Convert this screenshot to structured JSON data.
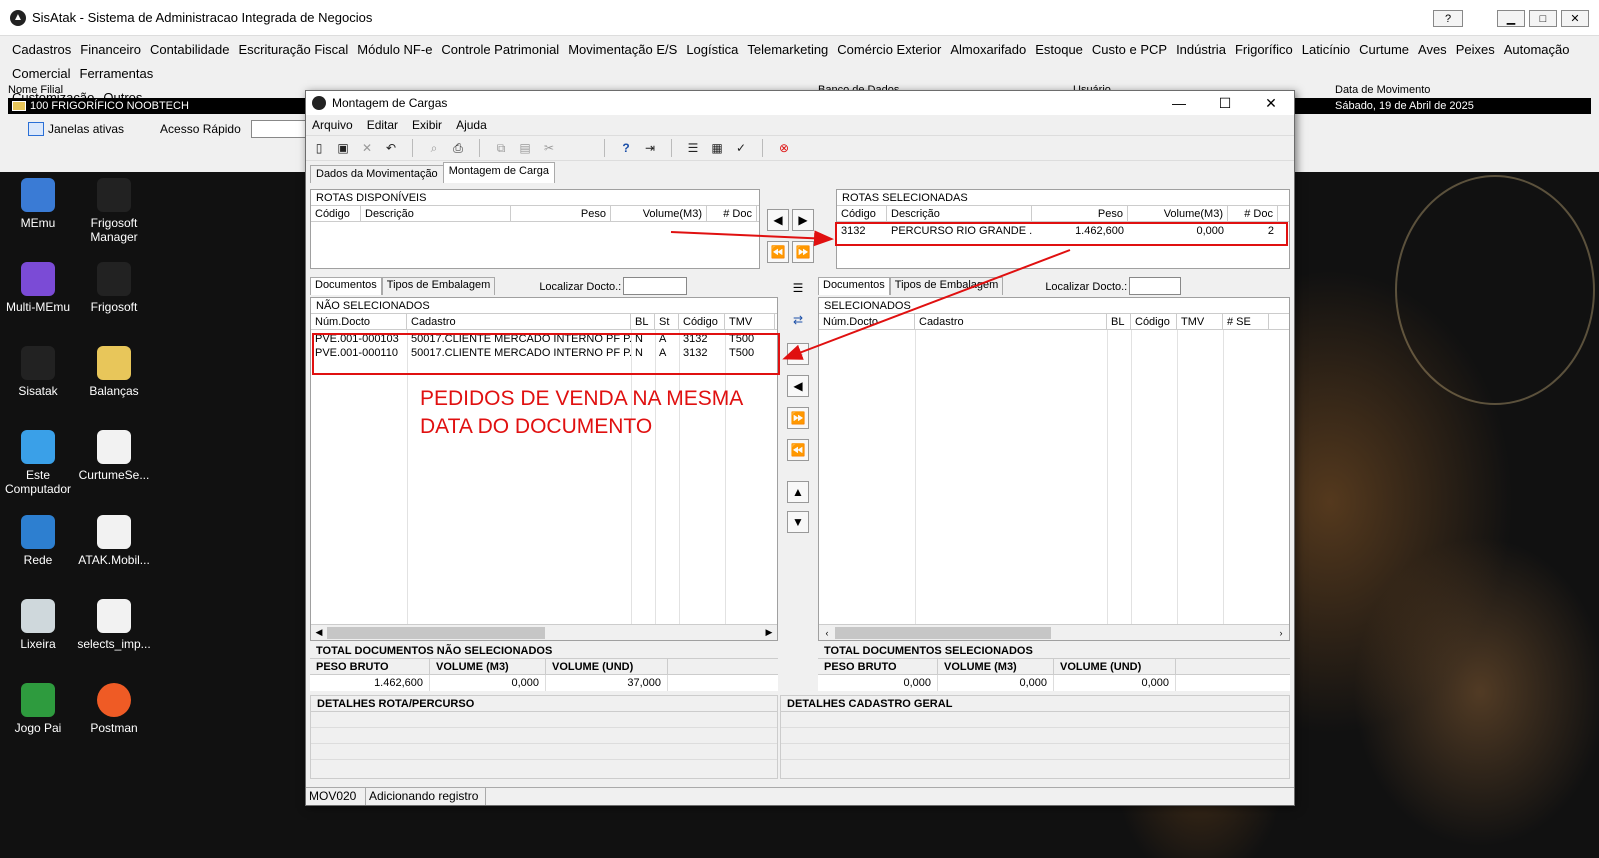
{
  "main": {
    "title": "SisAtak - Sistema de Administracao Integrada de Negocios",
    "help_label": "?",
    "menu": [
      "Cadastros",
      "Financeiro",
      "Contabilidade",
      "Escrituração Fiscal",
      "Módulo NF-e",
      "Controle Patrimonial",
      "Movimentação E/S",
      "Logística",
      "Telemarketing",
      "Comércio Exterior",
      "Almoxarifado",
      "Estoque",
      "Custo e PCP",
      "Indústria",
      "Frigorífico",
      "Laticínio",
      "Curtume",
      "Aves",
      "Peixes",
      "Automação Comercial",
      "Ferramentas"
    ],
    "menu2": [
      "Customização",
      "Outros"
    ],
    "filial_label": "Nome Filial",
    "filial_value": "100 FRIGORÍFICO NOOBTECH",
    "banco_label": "Banco de Dados",
    "usuario_label": "Usuário",
    "data_mov_label": "Data de Movimento",
    "data_mov_value": "Sábado, 19 de Abril de 2025",
    "janelas_label": "Janelas ativas",
    "acesso_label": "Acesso Rápido"
  },
  "desktop": [
    {
      "label": "MEmu",
      "icon": "memu-icon"
    },
    {
      "label": "Frigosoft Manager",
      "icon": "frigosoft-manager-icon"
    },
    {
      "label": "Multi-MEmu",
      "icon": "multi-memu-icon"
    },
    {
      "label": "Frigosoft",
      "icon": "frigosoft-icon"
    },
    {
      "label": "Sisatak",
      "icon": "sisatak-icon"
    },
    {
      "label": "Balanças",
      "icon": "folder-icon"
    },
    {
      "label": "Este Computador",
      "icon": "computer-icon"
    },
    {
      "label": "CurtumeSe...",
      "icon": "json-file-icon"
    },
    {
      "label": "Rede",
      "icon": "network-icon"
    },
    {
      "label": "ATAK.Mobil...",
      "icon": "apk-icon"
    },
    {
      "label": "Lixeira",
      "icon": "recycle-bin-icon"
    },
    {
      "label": "selects_imp...",
      "icon": "text-file-icon"
    },
    {
      "label": "Jogo Pai",
      "icon": "game-icon"
    },
    {
      "label": "Postman",
      "icon": "postman-icon"
    }
  ],
  "win": {
    "title": "Montagem de Cargas",
    "menu": [
      "Arquivo",
      "Editar",
      "Exibir",
      "Ajuda"
    ],
    "tabs": [
      "Dados da Movimentação",
      "Montagem de Carga"
    ],
    "rotas_disp": {
      "title": "ROTAS DISPONÍVEIS",
      "cols": [
        "Código",
        "Descrição",
        "Peso",
        "Volume(M3)",
        "# Doc"
      ]
    },
    "rotas_sel": {
      "title": "ROTAS SELECIONADAS",
      "cols": [
        "Código",
        "Descrição",
        "Peso",
        "Volume(M3)",
        "# Doc"
      ],
      "rows": [
        {
          "codigo": "3132",
          "descricao": "PERCURSO RIO GRANDE ...",
          "peso": "1.462,600",
          "volume": "0,000",
          "doc": "2"
        }
      ]
    },
    "left_tabs": [
      "Documentos",
      "Tipos de Embalagem"
    ],
    "right_tabs": [
      "Documentos",
      "Tipos de Embalagem"
    ],
    "localizar_label": "Localizar Docto.:",
    "nao_sel": {
      "title": "NÃO SELECIONADOS",
      "cols": [
        "Núm.Docto",
        "Cadastro",
        "BL",
        "St",
        "Código",
        "TMV"
      ],
      "rows": [
        {
          "num": "PVE.001-000103",
          "cad": "50017.CLIENTE MERCADO INTERNO PF P...",
          "bl": "N",
          "st": "A",
          "cod": "3132",
          "tmv": "T500"
        },
        {
          "num": "PVE.001-000110",
          "cad": "50017.CLIENTE MERCADO INTERNO PF P...",
          "bl": "N",
          "st": "A",
          "cod": "3132",
          "tmv": "T500"
        }
      ]
    },
    "sel": {
      "title": "SELECIONADOS",
      "cols": [
        "Núm.Docto",
        "Cadastro",
        "BL",
        "Código",
        "TMV",
        "# SE"
      ]
    },
    "tot_nao": {
      "title": "TOTAL DOCUMENTOS NÃO SELECIONADOS",
      "cols": [
        "PESO BRUTO",
        "VOLUME (M3)",
        "VOLUME (UND)"
      ],
      "vals": [
        "1.462,600",
        "0,000",
        "37,000"
      ]
    },
    "tot_sel": {
      "title": "TOTAL DOCUMENTOS SELECIONADOS",
      "cols": [
        "PESO BRUTO",
        "VOLUME (M3)",
        "VOLUME (UND)"
      ],
      "vals": [
        "0,000",
        "0,000",
        "0,000"
      ]
    },
    "detalhes_rota": "DETALHES ROTA/PERCURSO",
    "detalhes_cad": "DETALHES CADASTRO GERAL",
    "status": [
      "MOV020",
      "Adicionando registro"
    ]
  },
  "annotation": {
    "line1": "PEDIDOS DE VENDA NA MESMA",
    "line2": "DATA DO DOCUMENTO",
    "color": "#e01010"
  }
}
